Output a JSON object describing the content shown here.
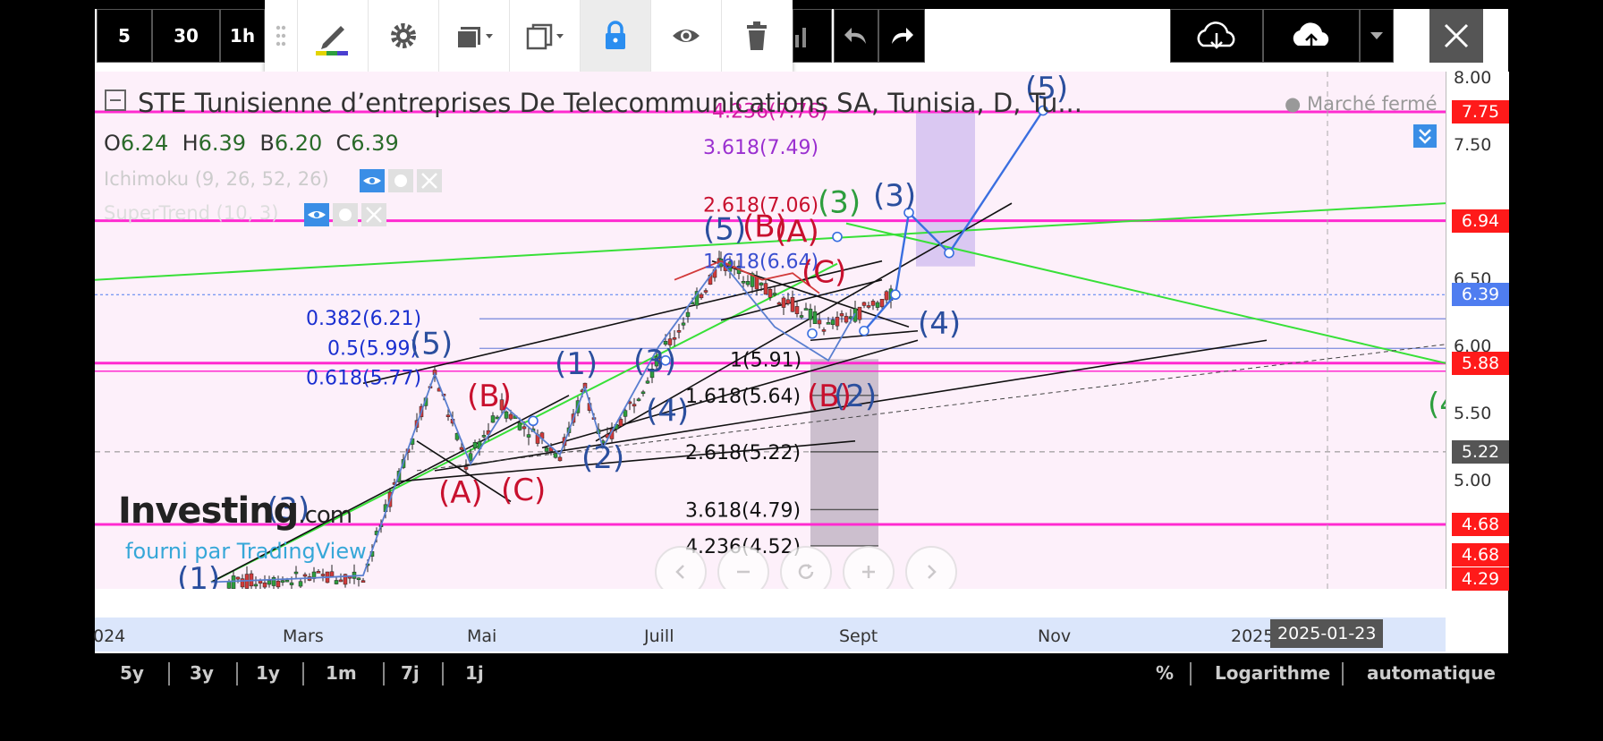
{
  "toolbar": {
    "intervals": [
      "5",
      "30",
      "1h"
    ],
    "drawing_tools": [
      "pencil-icon",
      "gear-icon",
      "layers-icon",
      "copy-icon",
      "lock-icon",
      "eye-icon",
      "trash-icon"
    ],
    "nav": [
      "undo-icon",
      "redo-icon"
    ],
    "cloud": [
      "cloud-download-icon",
      "cloud-upload-icon",
      "chevron-down-icon"
    ],
    "close": "close-icon"
  },
  "legend": {
    "title": "STE Tunisienne d’entreprises De Telecommunications SA, Tunisia, D, Tu...",
    "status": "● Marché fermé",
    "o_label": "O",
    "o": "6.24",
    "h_label": "H",
    "h": "6.39",
    "b_label": "B",
    "b": "6.20",
    "c_label": "C",
    "c": "6.39",
    "ichimoku": "Ichimoku (9, 26, 52, 26)",
    "supertrend": "SuperTrend (10, 3)"
  },
  "watermark": {
    "brand": "Investing",
    "suffix": ".com",
    "provider": "fourni par TradingView"
  },
  "colors": {
    "red_line": "#ff2bd0",
    "price_up": "#2e9e3e",
    "price_down": "#d23a3a",
    "wave_blue": "#2b4f9e",
    "wave_red": "#c8102e",
    "wave_green": "#2e9e3e"
  },
  "chart_data": {
    "type": "line",
    "ylim": [
      4.2,
      8.05
    ],
    "price_ticks": [
      "8.00",
      "7.50",
      "6.50",
      "6.00",
      "5.50",
      "5.00"
    ],
    "price_labels": [
      {
        "value": "7.75",
        "color": "#ff1a1a"
      },
      {
        "value": "6.94",
        "color": "#ff1a1a"
      },
      {
        "value": "6.39",
        "color": "#4f7df0"
      },
      {
        "value": "5.88",
        "color": "#ff1a1a"
      },
      {
        "value": "5.22",
        "color": "#555555"
      },
      {
        "value": "4.68",
        "color": "#ff1a1a"
      },
      {
        "value": "4.68",
        "color": "#ff1a1a"
      },
      {
        "value": "4.29",
        "color": "#ff1a1a"
      }
    ],
    "time_labels": [
      "024",
      "Mars",
      "Mai",
      "Juill",
      "Sept",
      "Nov",
      "2025"
    ],
    "crosshair_date": "2025-01-23",
    "fib_retracement_left": [
      "0.382(6.21)",
      "0.5(5.99)",
      "0.618(5.77)"
    ],
    "fib_extension_right": [
      "4.236(7.76)",
      "3.618(7.49)",
      "2.618(7.06)",
      "1.618(6.64)",
      "1(5.91)",
      "1.618(5.64)",
      "2.618(5.22)",
      "3.618(4.79)",
      "4.236(4.52)"
    ],
    "wave_labels": {
      "blue": [
        "(1)",
        "(3)",
        "(5)",
        "(1)",
        "(2)",
        "(3)",
        "(4)",
        "(5)",
        "(3)",
        "(4)",
        "(5)",
        "(2)"
      ],
      "red": [
        "(A)",
        "(B)",
        "(C)",
        "(B)",
        "(A)",
        "(C)",
        "(B)"
      ],
      "green": [
        "(3)",
        "(4"
      ]
    },
    "price_path": [
      {
        "x": "Févr",
        "y": 4.25
      },
      {
        "x": "Avr",
        "y": 4.3
      },
      {
        "x": "Mai",
        "y": 5.8
      },
      {
        "x": "Mai",
        "y": 5.13
      },
      {
        "x": "Mai",
        "y": 5.55
      },
      {
        "x": "Juin",
        "y": 5.2
      },
      {
        "x": "Juill",
        "y": 5.7
      },
      {
        "x": "Juill",
        "y": 5.25
      },
      {
        "x": "Août",
        "y": 6.64
      },
      {
        "x": "Sept",
        "y": 6.15
      },
      {
        "x": "Oct",
        "y": 6.39
      }
    ],
    "projection": [
      {
        "x": "Oct",
        "y": 6.39
      },
      {
        "x": "Oct",
        "y": 7.0
      },
      {
        "x": "Nov",
        "y": 6.7
      },
      {
        "x": "Déc",
        "y": 7.76
      }
    ]
  },
  "zoom_controls": [
    "chevron-left-icon",
    "minus-icon",
    "reset-icon",
    "plus-icon",
    "chevron-right-icon"
  ],
  "bottom": {
    "ranges": [
      "5y",
      "3y",
      "1y",
      "1m",
      "7j",
      "1j"
    ],
    "percent": "%",
    "log": "Logarithme",
    "auto": "automatique"
  }
}
